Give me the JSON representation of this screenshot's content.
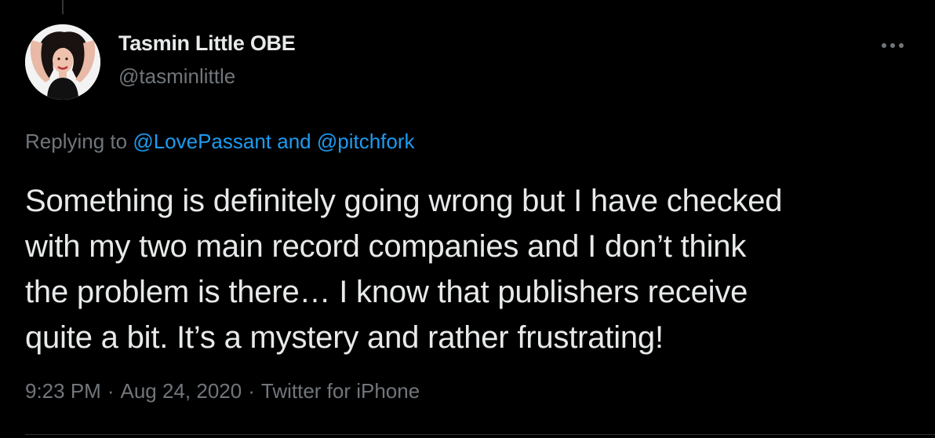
{
  "tweet": {
    "author_name": "Tasmin Little OBE",
    "author_handle": "@tasminlittle",
    "replying_prefix": "Replying to ",
    "reply_to_1": "@LovePassant",
    "reply_joiner": " and ",
    "reply_to_2": "@pitchfork",
    "line_1": "Something is definitely going wrong but I have checked",
    "line_2": "with my two main record companies and I don’t think",
    "line_3": "the problem is there… I know that publishers receive",
    "line_4": "quite a bit. It’s a mystery and rather frustrating!",
    "time": "9:23 PM",
    "date": "Aug 24, 2020",
    "source": "Twitter for iPhone",
    "separator": "·"
  },
  "icons": {
    "more": "more-horizontal-icon",
    "avatar": "profile-photo"
  },
  "colors": {
    "background": "#000000",
    "text": "#e7e9ea",
    "muted": "#71767b",
    "link": "#1d9bf0"
  }
}
